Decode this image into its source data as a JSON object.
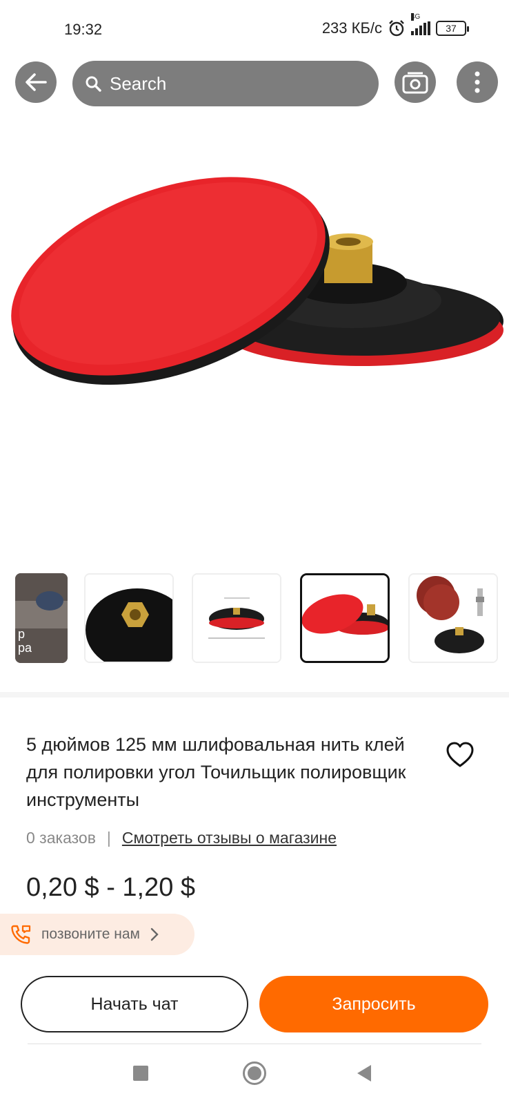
{
  "status_bar": {
    "time": "19:32",
    "speed": "233 КБ/с",
    "network": "4G",
    "battery": "37",
    "icons": [
      "alarm-icon",
      "signal-icon",
      "battery-icon"
    ]
  },
  "nav": {
    "search_placeholder": "Search",
    "icons": [
      "back-arrow-icon",
      "search-icon",
      "camera-icon",
      "more-vertical-icon"
    ]
  },
  "gallery": {
    "thumbnails": [
      {
        "caption": "р\nра"
      },
      {
        "caption": ""
      },
      {
        "caption": ""
      },
      {
        "caption": ""
      },
      {
        "caption": ""
      }
    ],
    "selected_index": 3
  },
  "product": {
    "title": "5 дюймов 125 мм шлифовальная нить клей для полировки угол Точильщик полировщик инструменты",
    "orders": "0 заказов",
    "separator": "|",
    "reviews_link": "Смотреть отзывы о магазине",
    "price": "0,20 $ - 1,20 $"
  },
  "call": {
    "label": "позвоните нам",
    "icons": [
      "phone-call-icon",
      "chevron-right-icon"
    ]
  },
  "actions": {
    "chat_label": "Начать чат",
    "request_label": "Запросить"
  },
  "colors": {
    "accent": "#ff6a00",
    "nav_button": "#7d7d7d",
    "call_bg": "#fdece2",
    "disc_red": "#e8242a"
  }
}
